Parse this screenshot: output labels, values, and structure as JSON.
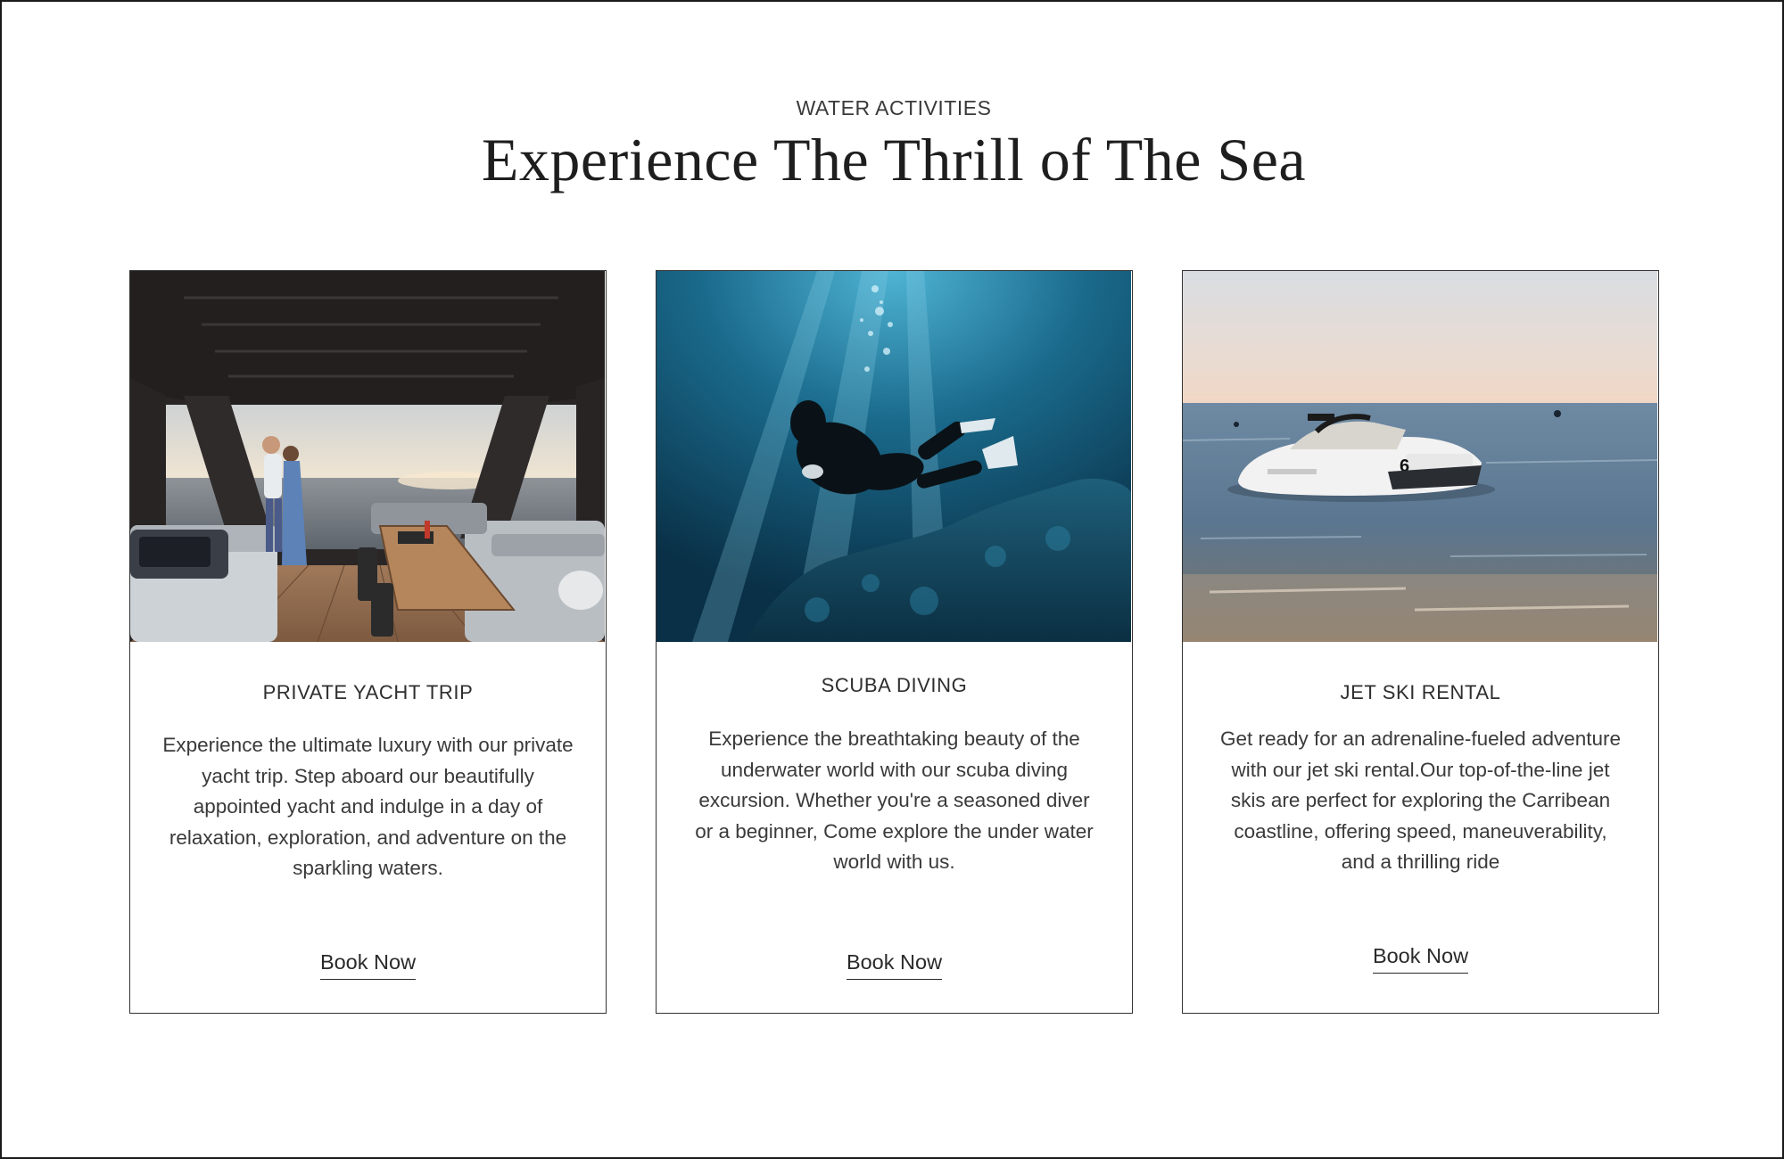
{
  "section": {
    "eyebrow": "WATER ACTIVITIES",
    "title": "Experience The Thrill of The Sea"
  },
  "cards": [
    {
      "image_alt": "Couple on a luxury yacht deck at sunset",
      "title": "PRIVATE YACHT TRIP",
      "description": "Experience the ultimate luxury with our private yacht trip. Step aboard our beautifully appointed yacht and indulge in a day of relaxation, exploration, and adventure on the sparkling waters.",
      "cta": "Book Now"
    },
    {
      "image_alt": "Scuba diver swimming underwater",
      "title": "SCUBA DIVING",
      "description": "Experience the breathtaking beauty of the underwater world with our scuba diving excursion. Whether you're a seasoned diver or a beginner,  Come explore the under water world with us.",
      "cta": "Book Now"
    },
    {
      "image_alt": "Jet ski floating on the sea",
      "title": "JET SKI RENTAL",
      "description": "Get ready for an adrenaline-fueled adventure with our jet ski rental.Our top-of-the-line jet skis are perfect for exploring the Carribean coastline, offering speed, maneuverability, and a thrilling ride",
      "cta": "Book Now"
    }
  ]
}
